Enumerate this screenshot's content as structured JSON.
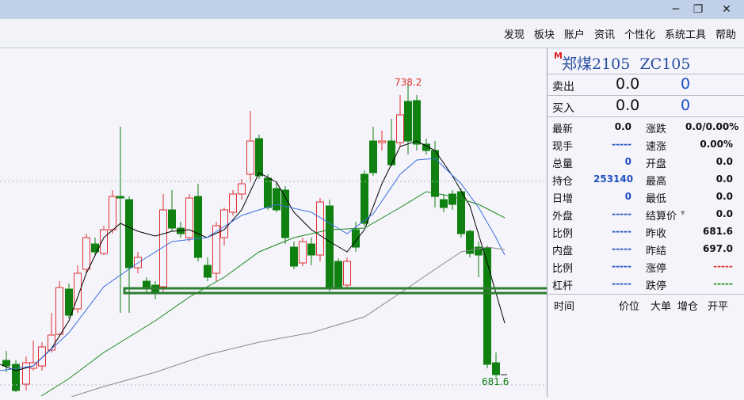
{
  "window": {
    "minimize_glyph": "─",
    "maximize_glyph": "❐",
    "close_glyph": "✕"
  },
  "menu": [
    "发现",
    "板块",
    "账户",
    "资讯",
    "个性化",
    "系统工具",
    "帮助"
  ],
  "instrument": {
    "marker": "M",
    "name": "郑煤2105",
    "code": "ZC105"
  },
  "orderbook": {
    "sell": {
      "label": "卖出",
      "price": "0.0",
      "volume": "0"
    },
    "buy": {
      "label": "买入",
      "price": "0.0",
      "volume": "0"
    }
  },
  "quote": {
    "rows": [
      {
        "l": "最新",
        "lv": "0.0",
        "lc": "#111111",
        "r": "涨跌",
        "rv": "0.0/0.00%",
        "rc": "#111111"
      },
      {
        "l": "现手",
        "lv": "-----",
        "lc": "#2050c0",
        "r": "速涨",
        "rv": "0.00%",
        "rc": "#111111"
      },
      {
        "l": "总量",
        "lv": "0",
        "lc": "#2050c0",
        "r": "开盘",
        "rv": "0.0",
        "rc": "#111111"
      },
      {
        "l": "持仓",
        "lv": "253140",
        "lc": "#2050c0",
        "r": "最高",
        "rv": "0.0",
        "rc": "#111111"
      },
      {
        "l": "日增",
        "lv": "0",
        "lc": "#2050c0",
        "r": "最低",
        "rv": "0.0",
        "rc": "#111111"
      },
      {
        "l": "外盘",
        "lv": "-----",
        "lc": "#2050c0",
        "r": "结算价",
        "rv": "0.0",
        "rc": "#111111"
      },
      {
        "l": "比例",
        "lv": "-----",
        "lc": "#2050c0",
        "r": "昨收",
        "rv": "681.6",
        "rc": "#111111"
      },
      {
        "l": "内盘",
        "lv": "-----",
        "lc": "#2050c0",
        "r": "昨结",
        "rv": "697.0",
        "rc": "#111111"
      },
      {
        "l": "比例",
        "lv": "-----",
        "lc": "#2050c0",
        "r": "涨停",
        "rv": "-----",
        "rc": "#e03030"
      },
      {
        "l": "杠杆",
        "lv": "-----",
        "lc": "#2050c0",
        "r": "跌停",
        "rv": "-----",
        "rc": "#209020"
      }
    ]
  },
  "ticks_header": [
    "时间",
    "价位",
    "大单",
    "增仓",
    "开平"
  ],
  "chart_data": {
    "type": "candlestick",
    "high_label": "738.2",
    "low_label": "681.6",
    "colors": {
      "up": "#e03030",
      "down": "#108010",
      "ma5": "#000000",
      "ma10": "#3c6ee0",
      "ma20": "#1a8a1a",
      "ma60": "#8a8a8a",
      "support": "#2e7d32"
    }
  }
}
